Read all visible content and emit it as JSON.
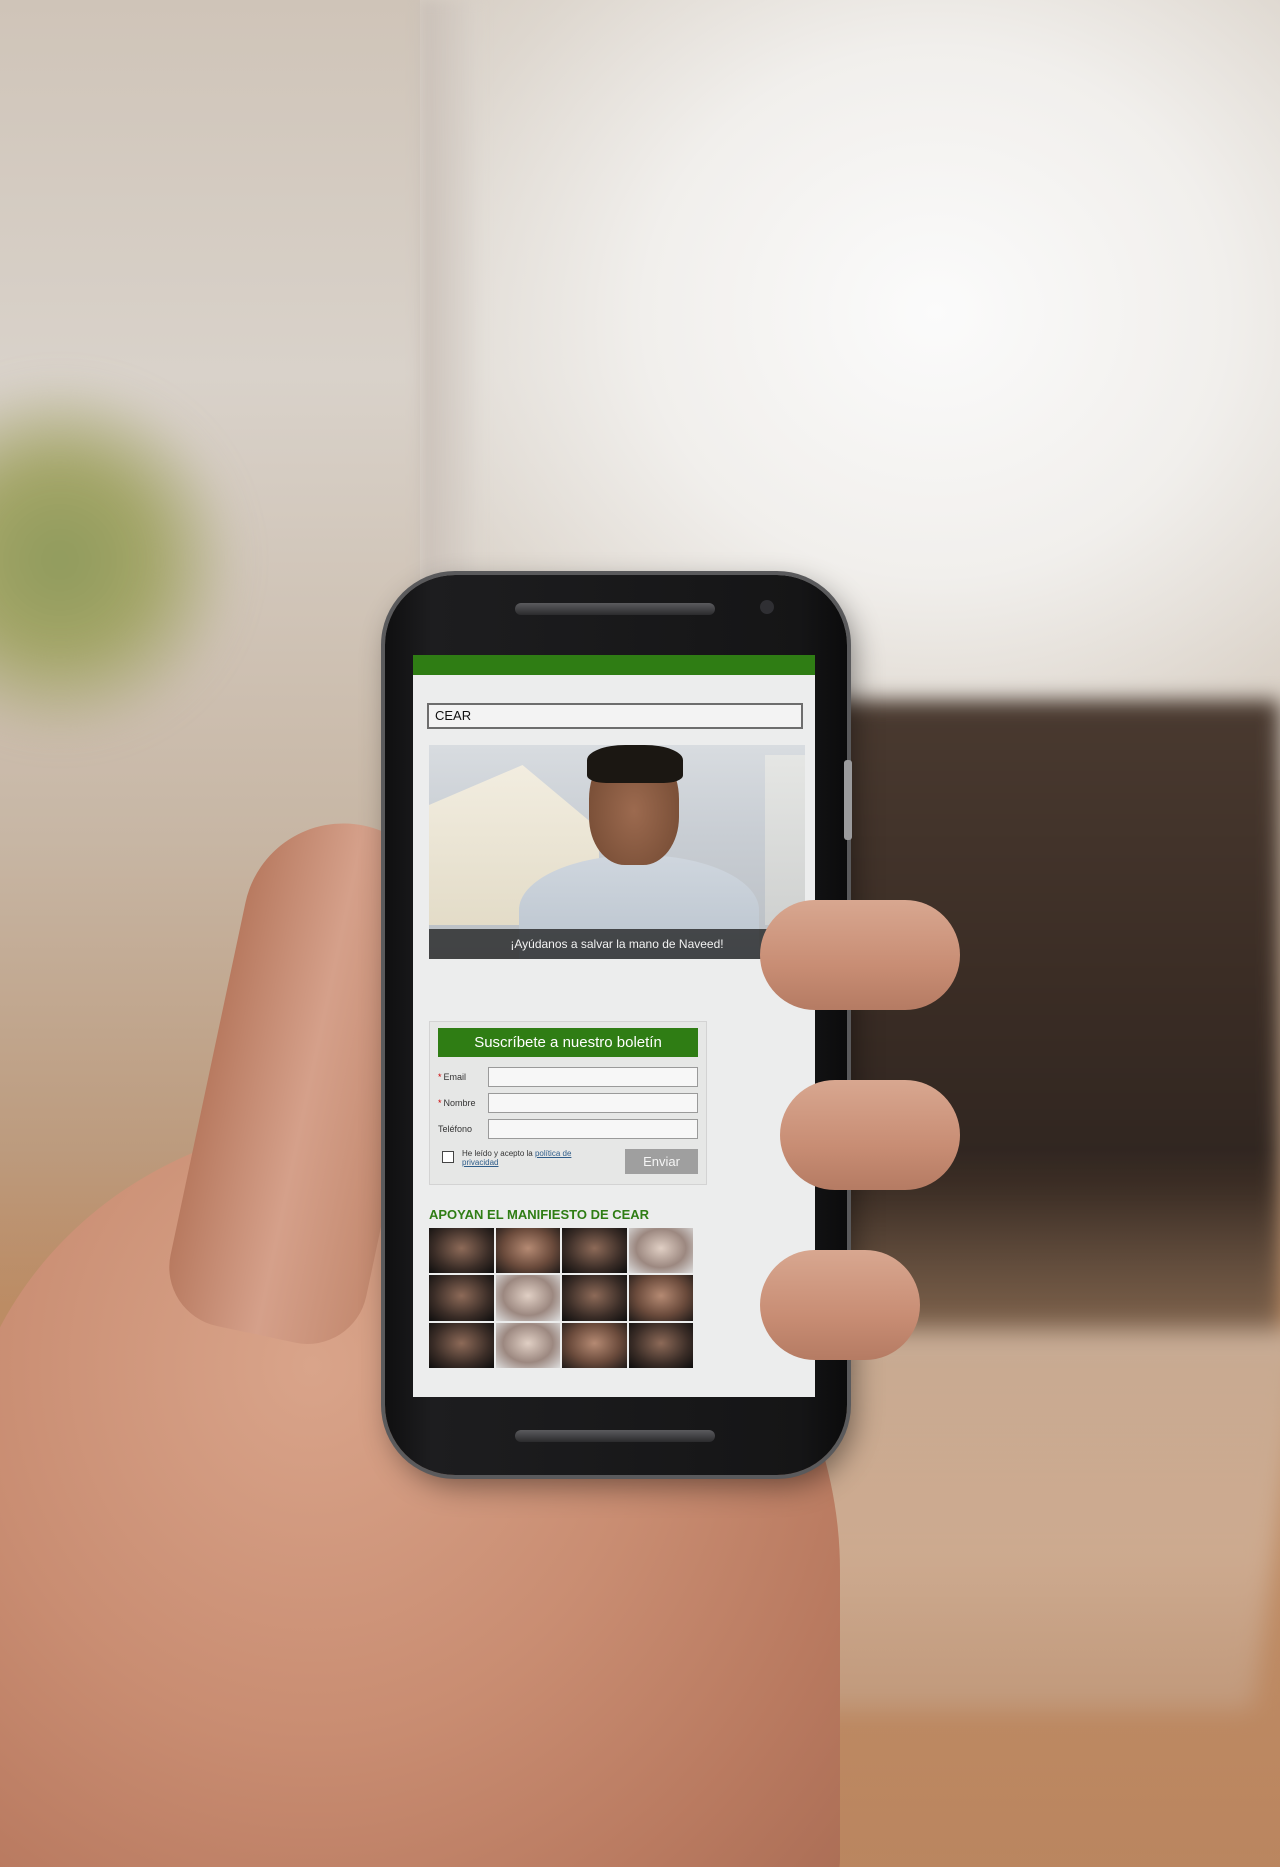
{
  "screen": {
    "site_title_field": "CEAR",
    "video_caption": "¡Ayúdanos a salvar la mano de Naveed!",
    "newsletter": {
      "title": "Suscríbete a nuestro boletín",
      "email_label": "Email",
      "name_label": "Nombre",
      "phone_label": "Teléfono",
      "consent_text": "He leído y acepto la ",
      "consent_link": "política de privacidad",
      "submit_label": "Enviar"
    },
    "manifest_heading": "APOYAN EL MANIFIESTO DE CEAR",
    "supporter_photos_count": 12
  },
  "colors": {
    "accent_green": "#2f7d14",
    "button_gray": "#9f9f9f"
  }
}
